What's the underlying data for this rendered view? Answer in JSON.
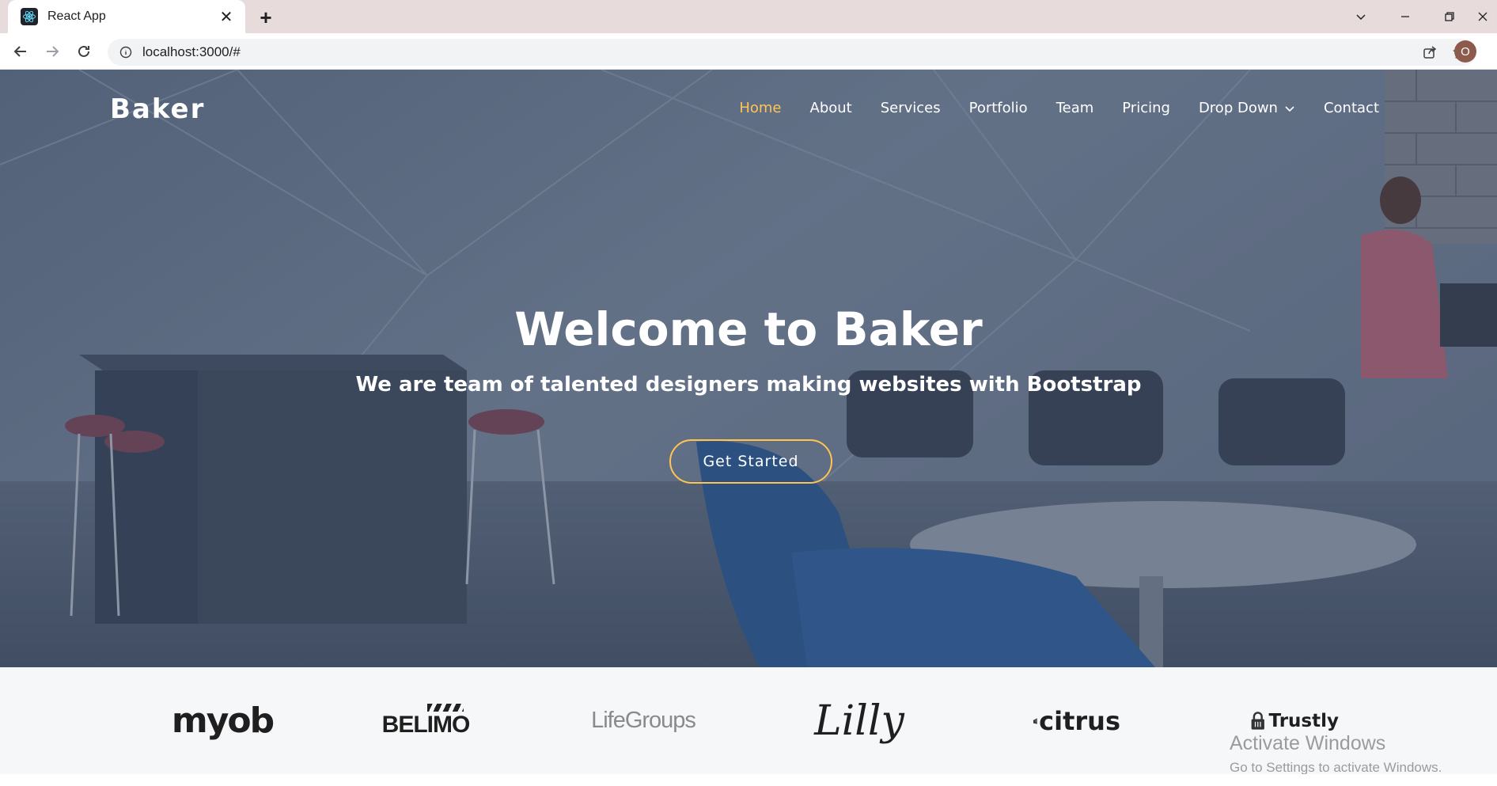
{
  "browser": {
    "tab_title": "React App",
    "url": "localhost:3000/#",
    "profile_initial": "O"
  },
  "site": {
    "logo": "Baker",
    "nav": [
      {
        "label": "Home",
        "active": true
      },
      {
        "label": "About"
      },
      {
        "label": "Services"
      },
      {
        "label": "Portfolio"
      },
      {
        "label": "Team"
      },
      {
        "label": "Pricing"
      },
      {
        "label": "Drop Down",
        "dropdown": true
      },
      {
        "label": "Contact"
      }
    ],
    "hero": {
      "title": "Welcome to Baker",
      "subtitle": "We are team of talented designers making websites with Bootstrap",
      "cta": "Get Started"
    },
    "clients": [
      "myob",
      "BELIMO",
      "LifeGroups",
      "Lilly",
      "citrus",
      "Trustly"
    ]
  },
  "colors": {
    "accent": "#ffc451",
    "tab_strip": "#e7dcdb"
  },
  "watermark": {
    "title": "Activate Windows",
    "subtitle": "Go to Settings to activate Windows."
  }
}
